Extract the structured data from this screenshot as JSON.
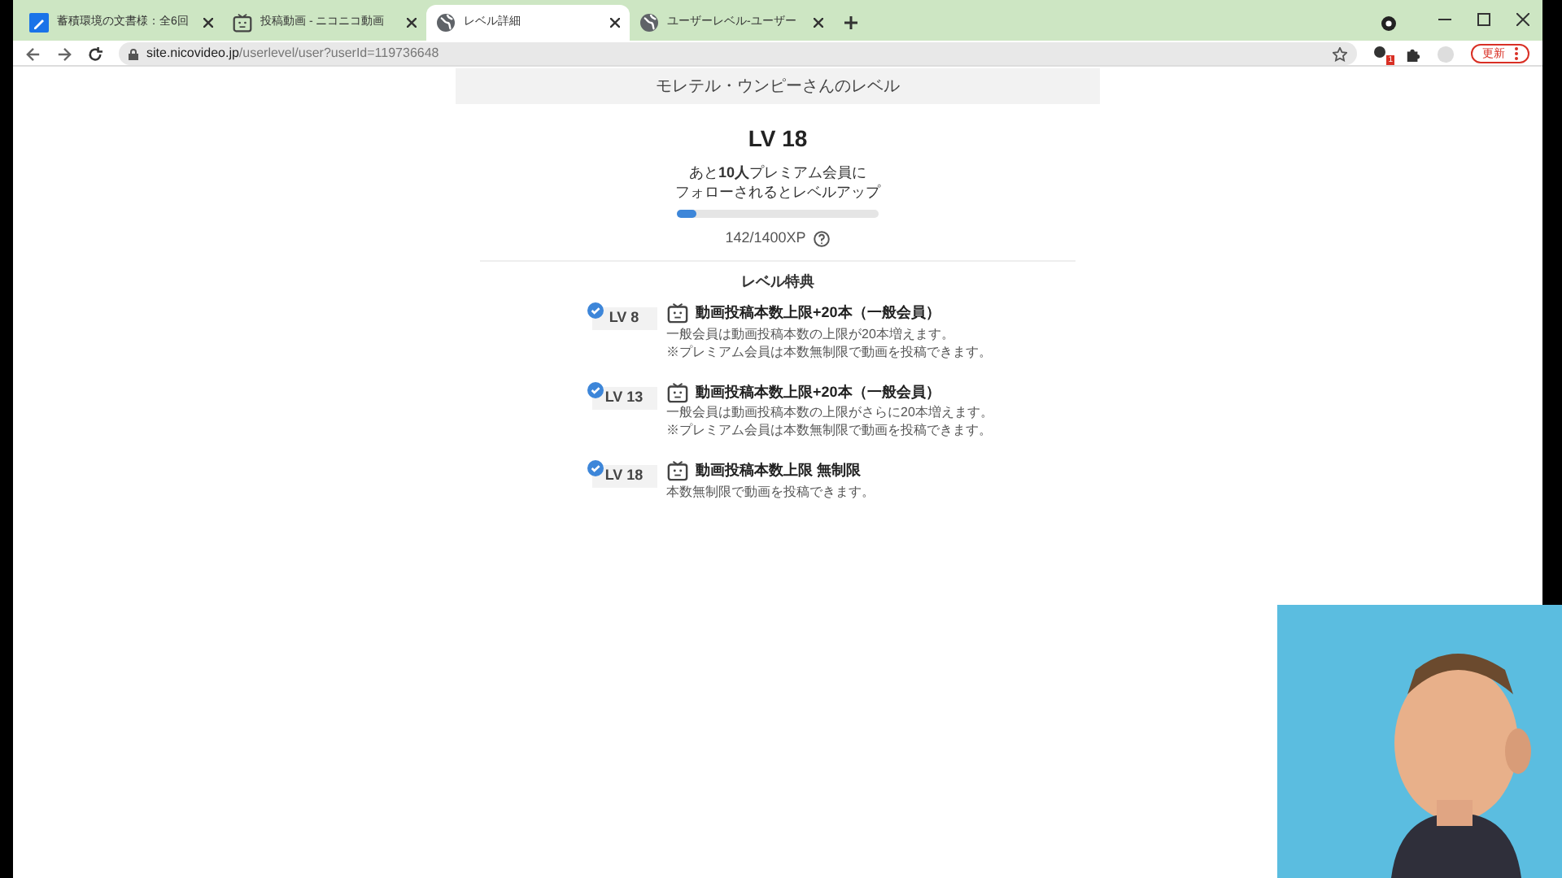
{
  "tabs": [
    {
      "title": "蓄積環境の文書様：全6回",
      "selected": false,
      "kind": "doc"
    },
    {
      "title": "投稿動画 - ニコニコ動画",
      "selected": false,
      "kind": "tv"
    },
    {
      "title": "レベル詳細",
      "selected": true,
      "kind": "globe"
    },
    {
      "title": "ユーザーレベル-ユーザー",
      "selected": false,
      "kind": "globe"
    }
  ],
  "address_bar": {
    "host": "site.nicovideo.jp",
    "path": "/userlevel/user?userId=119736648"
  },
  "extension_badge": "1",
  "update_button": "更新",
  "page": {
    "header": "モレテル・ウンピーさんのレベル",
    "level_title": "LV 18",
    "next_level_message": "あと**10人**プレミアム会員に",
    "next_level_message_2": "フォローされるとレベルアップ",
    "xp_progress": {
      "level": 0.1
    },
    "xp_text": "142/1400XP",
    "perks_title": "レベル特典",
    "perks": [
      {
        "level": "LV 8",
        "achieved": true,
        "title": "動画投稿本数上限+20本（一般会員）",
        "lines": [
          "一般会員は動画投稿本数の上限が20本増えます。",
          "※プレミアム会員は本数無制限で動画を投稿できます。"
        ]
      },
      {
        "level": "LV 13",
        "achieved": true,
        "title": "動画投稿本数上限+20本（一般会員）",
        "lines": [
          "一般会員は動画投稿本数の上限がさらに20本増えます。",
          "※プレミアム会員は本数無制限で動画を投稿できます。"
        ]
      },
      {
        "level": "LV 18",
        "achieved": true,
        "title": "動画投稿本数上限 無制限",
        "lines": [
          "本数無制限で動画を投稿できます。"
        ]
      }
    ]
  }
}
